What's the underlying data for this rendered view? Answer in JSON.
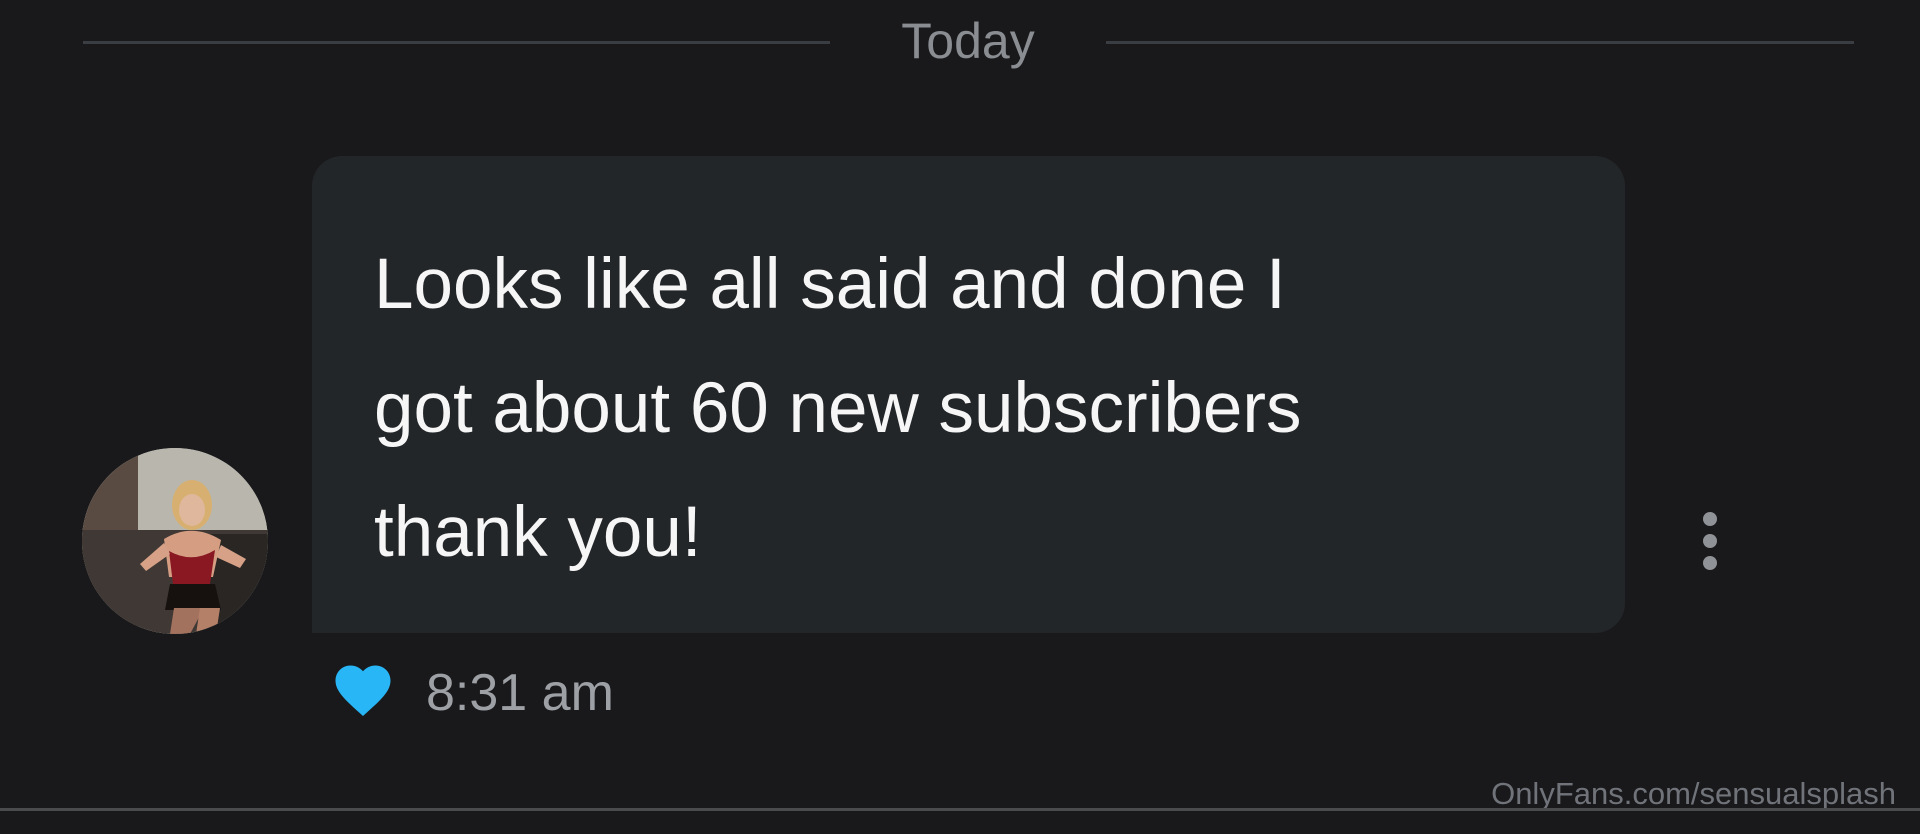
{
  "date_divider": {
    "label": "Today"
  },
  "message": {
    "lines": [
      "Looks like all said and done I",
      "got about 60 new subscribers",
      "thank you!"
    ],
    "timestamp": "8:31 am",
    "liked": true,
    "like_icon": "heart-icon",
    "more_icon": "vertical-ellipsis-icon"
  },
  "watermark": {
    "text": "OnlyFans.com/sensualsplash"
  },
  "colors": {
    "background": "#19191b",
    "bubble": "#232629",
    "message_text": "#f6f6f6",
    "secondary_text": "#9da0a5",
    "like_heart": "#29b6f6"
  }
}
